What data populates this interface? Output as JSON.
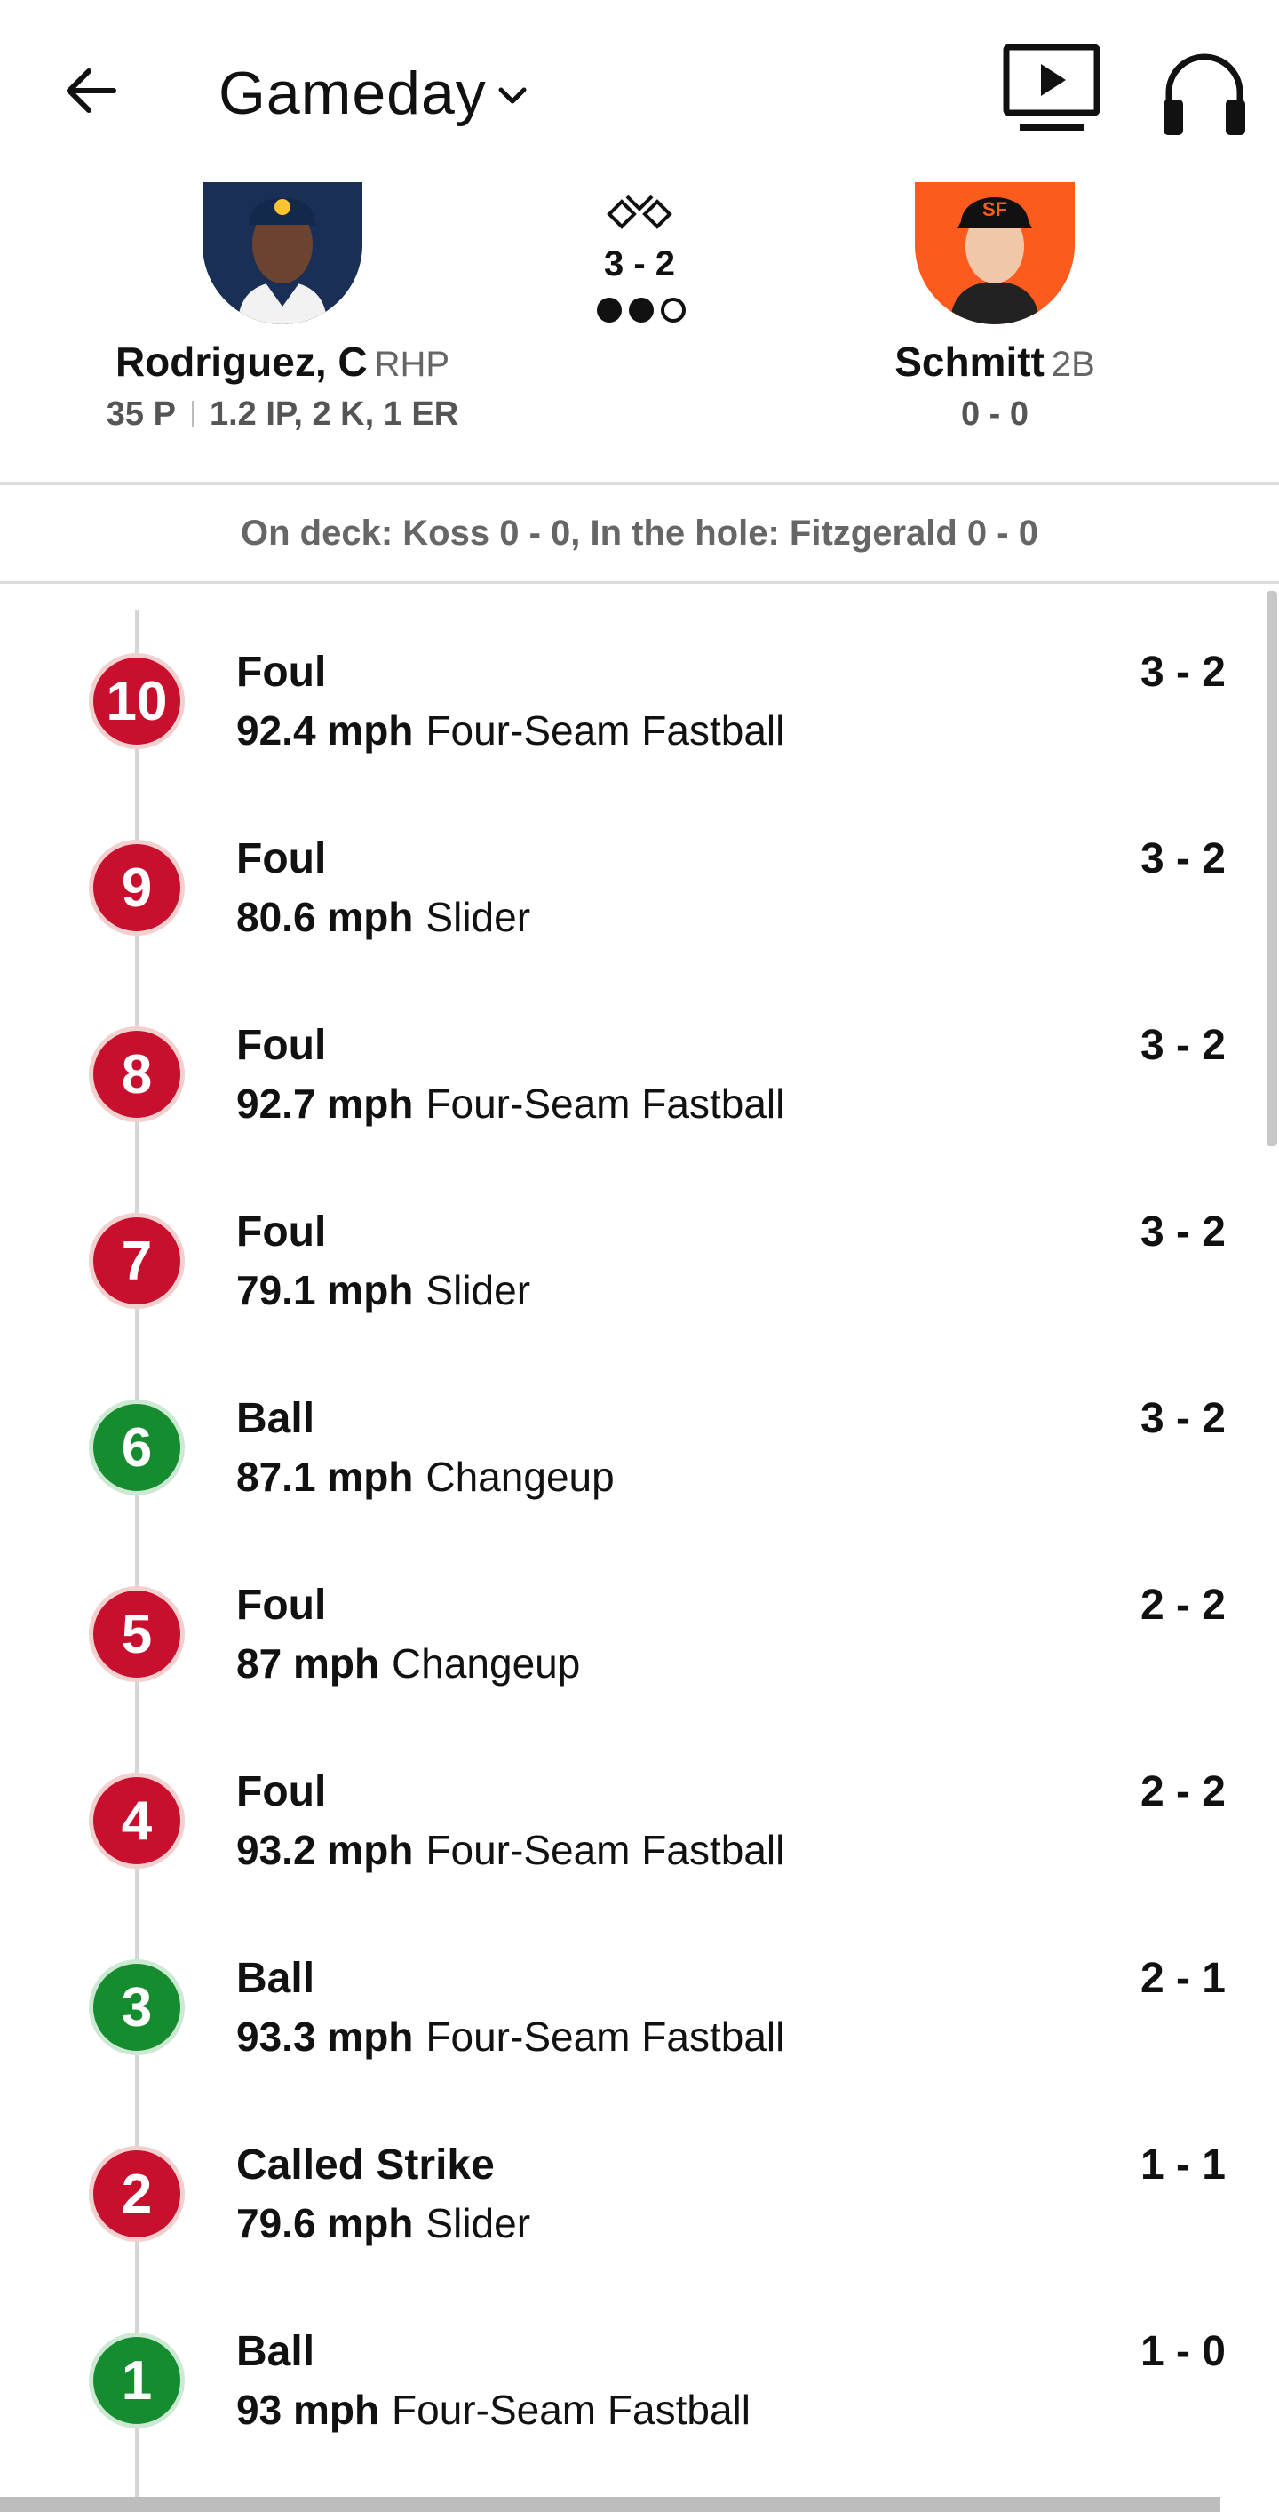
{
  "header": {
    "title": "Gameday",
    "icons": {
      "back": "arrow-left-icon",
      "title_menu": "chevron-down-icon",
      "video": "play-video-icon",
      "audio": "headphones-icon"
    }
  },
  "matchup": {
    "pitcher": {
      "name": "Rodriguez, C",
      "position": "RHP",
      "pitches": "35 P",
      "line": "1.2 IP, 2 K, 1 ER"
    },
    "batter": {
      "name": "Schmitt",
      "position": "2B",
      "line": "0 - 0"
    },
    "count": "3 - 2",
    "outs": 2,
    "on_deck_text": "On deck: Koss 0 - 0, In the hole: Fitzgerald 0 - 0"
  },
  "colors": {
    "strike": "#c8102e",
    "ball": "#158c2f",
    "brewers_navy": "#1a2f55",
    "giants_orange": "#fd5a1e"
  },
  "pitches": [
    {
      "number": "10",
      "result": "Foul",
      "speed": "92.4 mph",
      "type": "Four-Seam Fastball",
      "count": "3 - 2",
      "kind": "strike"
    },
    {
      "number": "9",
      "result": "Foul",
      "speed": "80.6 mph",
      "type": "Slider",
      "count": "3 - 2",
      "kind": "strike"
    },
    {
      "number": "8",
      "result": "Foul",
      "speed": "92.7 mph",
      "type": "Four-Seam Fastball",
      "count": "3 - 2",
      "kind": "strike"
    },
    {
      "number": "7",
      "result": "Foul",
      "speed": "79.1 mph",
      "type": "Slider",
      "count": "3 - 2",
      "kind": "strike"
    },
    {
      "number": "6",
      "result": "Ball",
      "speed": "87.1 mph",
      "type": "Changeup",
      "count": "3 - 2",
      "kind": "ball"
    },
    {
      "number": "5",
      "result": "Foul",
      "speed": "87 mph",
      "type": "Changeup",
      "count": "2 - 2",
      "kind": "strike"
    },
    {
      "number": "4",
      "result": "Foul",
      "speed": "93.2 mph",
      "type": "Four-Seam Fastball",
      "count": "2 - 2",
      "kind": "strike"
    },
    {
      "number": "3",
      "result": "Ball",
      "speed": "93.3 mph",
      "type": "Four-Seam Fastball",
      "count": "2 - 1",
      "kind": "ball"
    },
    {
      "number": "2",
      "result": "Called Strike",
      "speed": "79.6 mph",
      "type": "Slider",
      "count": "1 - 1",
      "kind": "strike"
    },
    {
      "number": "1",
      "result": "Ball",
      "speed": "93 mph",
      "type": "Four-Seam Fastball",
      "count": "1 - 0",
      "kind": "ball"
    }
  ]
}
